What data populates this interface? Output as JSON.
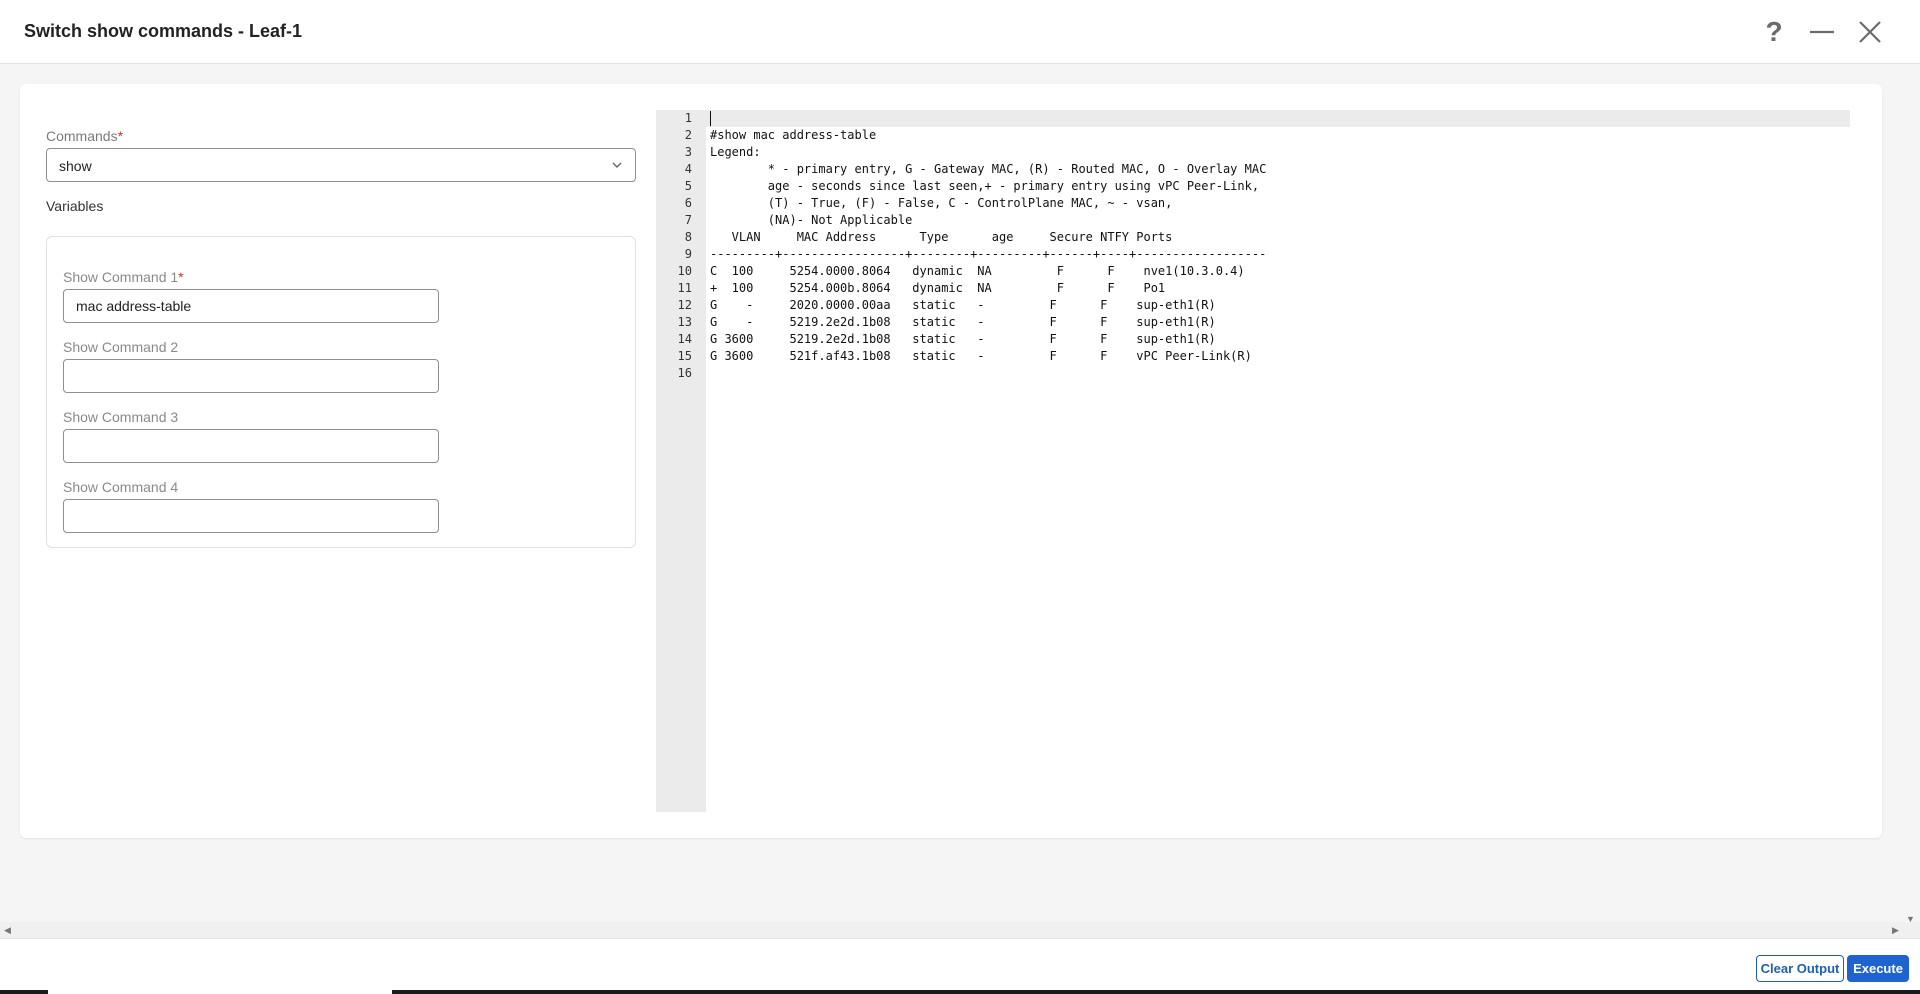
{
  "header": {
    "title": "Switch show commands - Leaf-1",
    "help_glyph": "?",
    "icons": [
      "help-icon",
      "minimize-icon",
      "close-icon"
    ]
  },
  "form": {
    "commands_label": "Commands",
    "required_mark": "*",
    "commands_value": "show",
    "variables_label": "Variables",
    "fields": [
      {
        "label": "Show Command 1",
        "required": true,
        "value": "mac address-table"
      },
      {
        "label": "Show Command 2",
        "required": false,
        "value": ""
      },
      {
        "label": "Show Command 3",
        "required": false,
        "value": ""
      },
      {
        "label": "Show Command 4",
        "required": false,
        "value": ""
      }
    ]
  },
  "editor": {
    "lines": [
      "",
      "#show mac address-table",
      "Legend:",
      "        * - primary entry, G - Gateway MAC, (R) - Routed MAC, O - Overlay MAC",
      "        age - seconds since last seen,+ - primary entry using vPC Peer-Link,",
      "        (T) - True, (F) - False, C - ControlPlane MAC, ~ - vsan,",
      "        (NA)- Not Applicable",
      "   VLAN     MAC Address      Type      age     Secure NTFY Ports",
      "---------+-----------------+--------+---------+------+----+------------------",
      "C  100     5254.0000.8064   dynamic  NA         F      F    nve1(10.3.0.4)",
      "+  100     5254.000b.8064   dynamic  NA         F      F    Po1",
      "G    -     2020.0000.00aa   static   -         F      F    sup-eth1(R)",
      "G    -     5219.2e2d.1b08   static   -         F      F    sup-eth1(R)",
      "G 3600     5219.2e2d.1b08   static   -         F      F    sup-eth1(R)",
      "G 3600     521f.af43.1b08   static   -         F      F    vPC Peer-Link(R)",
      ""
    ]
  },
  "footer": {
    "clear_label": "Clear Output",
    "execute_label": "Execute"
  },
  "colors": {
    "accent": "#1f63d1",
    "required": "#c0392b"
  }
}
